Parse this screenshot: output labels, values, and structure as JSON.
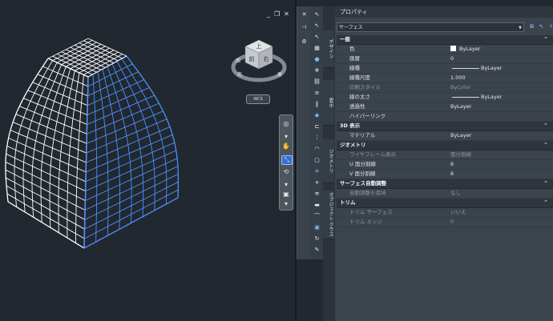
{
  "viewport": {
    "window_controls": [
      "_",
      "❐",
      "✕"
    ],
    "viewcube": {
      "top": "上",
      "front": "前",
      "right": "右",
      "west": "西",
      "south": "南",
      "east": "東"
    },
    "wcs_label": "WCS",
    "nav_icons": [
      "steering-wheel-icon",
      "pan-hand-icon",
      "zoom-extents-icon",
      "orbit-icon",
      "showmotion-icon"
    ]
  },
  "toolbar_icons": [
    "pointer-icon",
    "pointer-plus-icon",
    "pointer-minus-icon",
    "grid-icon",
    "sphere-icon",
    "snowflake-icon",
    "link-icon",
    "stack-icon",
    "vertical-lines-icon",
    "paint-icon",
    "bracket-icon",
    "dots-icon",
    "arc-icon",
    "square-icon",
    "crosshair-icon",
    "plus-icon",
    "lines-icon",
    "bar-icon",
    "fillet-icon",
    "cube-icon",
    "loop-icon",
    "brush-icon"
  ],
  "vtabs": {
    "design": "デザイン",
    "display": "表示",
    "geometry": "ジオメトリ",
    "object_class": "オブジェクト クラス"
  },
  "panel": {
    "title": "プロパティ",
    "selection": "サーフェス",
    "sections": [
      {
        "name": "一般",
        "rows": [
          {
            "k": "色",
            "v": "ByLayer",
            "swatch": "#ffffff"
          },
          {
            "k": "画層",
            "v": "0"
          },
          {
            "k": "線種",
            "v": "ByLayer",
            "line": true
          },
          {
            "k": "線種尺度",
            "v": "1.000"
          },
          {
            "k": "印刷スタイル",
            "v": "ByColor",
            "dim": true
          },
          {
            "k": "線の太さ",
            "v": "ByLayer",
            "line": true
          },
          {
            "k": "透過性",
            "v": "ByLayer"
          },
          {
            "k": "ハイパーリンク",
            "v": ""
          }
        ]
      },
      {
        "name": "3D 表示",
        "rows": [
          {
            "k": "マテリアル",
            "v": "ByLayer"
          }
        ]
      },
      {
        "name": "ジオメトリ",
        "rows": [
          {
            "k": "ワイヤフレーム表示",
            "v": "面分割線",
            "dim": true
          },
          {
            "k": "U 面分割線",
            "v": "6"
          },
          {
            "k": "V 面分割線",
            "v": "6"
          }
        ]
      },
      {
        "name": "サーフェス自動調整",
        "rows": [
          {
            "k": "自動調整を保持",
            "v": "なし",
            "dim": true
          }
        ]
      },
      {
        "name": "トリム",
        "rows": [
          {
            "k": "トリム サーフェス",
            "v": "いいえ",
            "dim": true
          },
          {
            "k": "トリム エッジ",
            "v": "0",
            "dim": true
          }
        ]
      }
    ]
  },
  "colors": {
    "background": "#212830",
    "wire_white": "#ffffff",
    "wire_selected": "#4d90ff",
    "panel": "#3b434d"
  }
}
